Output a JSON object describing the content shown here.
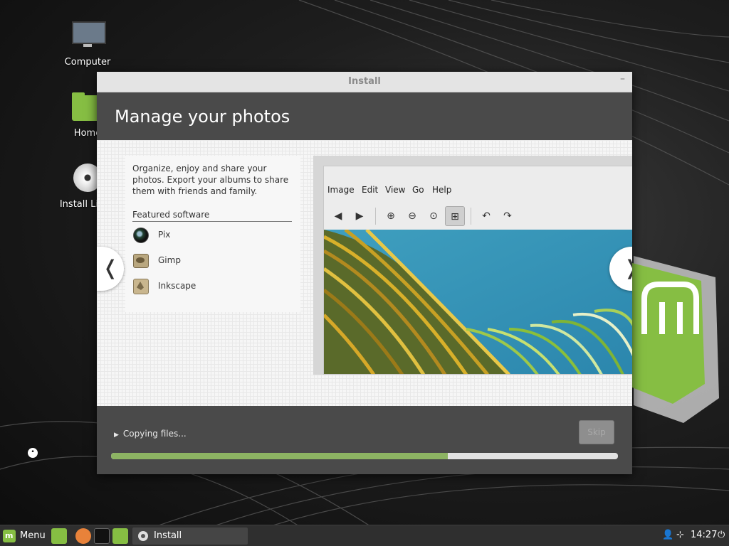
{
  "desktop": {
    "icons": [
      {
        "label": "Computer",
        "icon": "monitor-icon"
      },
      {
        "label": "Home",
        "icon": "home-folder-icon"
      },
      {
        "label": "Install Linux",
        "icon": "disc-icon"
      }
    ]
  },
  "window": {
    "title": "Install",
    "minimize_glyph": "–",
    "heading": "Manage your photos",
    "slide": {
      "description": "Organize, enjoy and share your photos. Export your albums to share them with friends and family.",
      "featured_label": "Featured software",
      "software": [
        {
          "name": "Pix",
          "icon": "pix-icon"
        },
        {
          "name": "Gimp",
          "icon": "gimp-icon"
        },
        {
          "name": "Inkscape",
          "icon": "inkscape-icon"
        }
      ],
      "screenshot_menu": [
        "Image",
        "Edit",
        "View",
        "Go",
        "Help"
      ]
    },
    "nav": {
      "prev": "❬",
      "next": "❭"
    },
    "status": "Copying files...",
    "skip_label": "Skip",
    "progress": 0.665
  },
  "taskbar": {
    "menu_label": "Menu",
    "task_label": "Install",
    "time": "14:27"
  },
  "colors": {
    "accent": "#8db463",
    "header_bg": "#4a4a4a",
    "mint_green": "#86be43"
  }
}
